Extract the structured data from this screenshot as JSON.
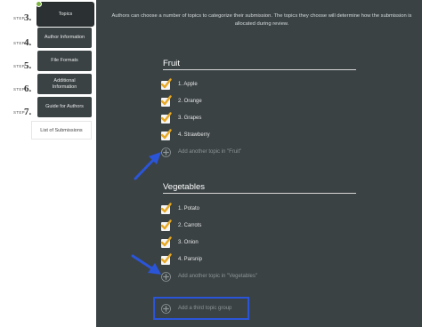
{
  "sidebar": {
    "step_word": "STEP",
    "steps": [
      {
        "num": "3.",
        "label": "Topics",
        "active": true
      },
      {
        "num": "4.",
        "label": "Author Information"
      },
      {
        "num": "5.",
        "label": "File Formats"
      },
      {
        "num": "6.",
        "label": "Additional Information"
      },
      {
        "num": "7.",
        "label": "Guide for Authors"
      }
    ],
    "list_label": "List of Submissions"
  },
  "main": {
    "intro": "Authors can choose a number of topics to categorize their submission. The topics they choose will determine how the submission is allocated during review.",
    "groups": [
      {
        "title": "Fruit",
        "topics": [
          "1. Apple",
          "2. Orange",
          "3. Grapes",
          "4. Strawberry"
        ],
        "add_label": "Add another topic in \"Fruit\""
      },
      {
        "title": "Vegetables",
        "topics": [
          "1. Potato",
          "2. Carrots",
          "3. Onion",
          "4. Parsnip"
        ],
        "add_label": "Add another topic in \"Vegetables\""
      }
    ],
    "add_group_label": "Add a third topic group"
  },
  "colors": {
    "panel": "#3a4244",
    "check": "#e8a823",
    "active_dot": "#7cb342",
    "annotation": "#2b55d9"
  }
}
